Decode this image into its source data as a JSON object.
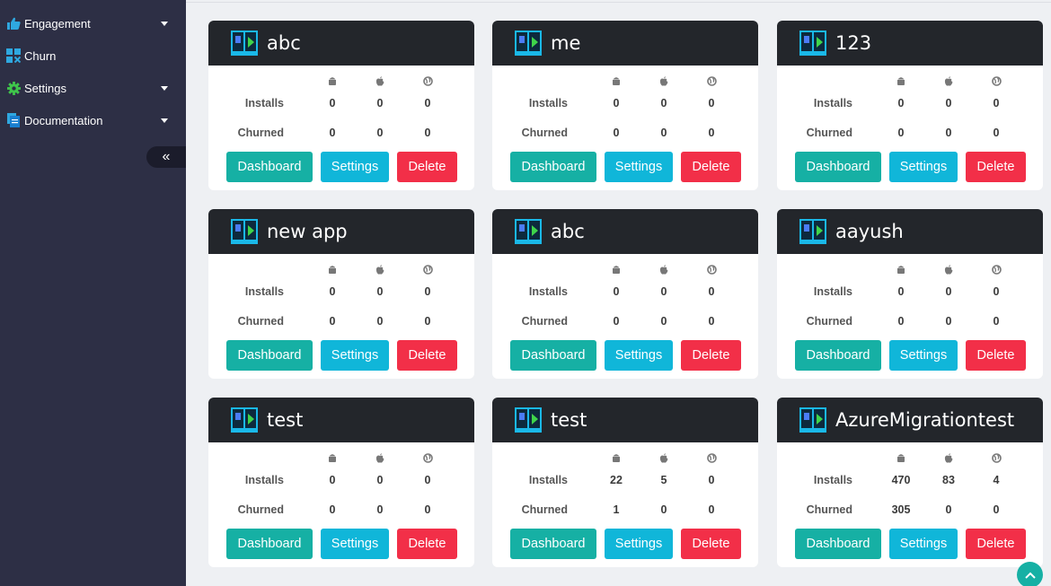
{
  "sidebar": {
    "items": [
      {
        "label": "Engagement",
        "icon": "thumbs-up-icon",
        "has_caret": true
      },
      {
        "label": "Churn",
        "icon": "churn-grid-icon",
        "has_caret": false
      },
      {
        "label": "Settings",
        "icon": "gear-icon",
        "has_caret": true
      },
      {
        "label": "Documentation",
        "icon": "document-icon",
        "has_caret": true
      }
    ],
    "collapse_label": "«"
  },
  "table_labels": {
    "installs": "Installs",
    "churned": "Churned"
  },
  "platform_icons": [
    "android-icon",
    "apple-icon",
    "globe-icon"
  ],
  "buttons": {
    "dashboard": "Dashboard",
    "settings": "Settings",
    "delete": "Delete"
  },
  "apps": [
    {
      "name": "abc",
      "installs": [
        "0",
        "0",
        "0"
      ],
      "churned": [
        "0",
        "0",
        "0"
      ]
    },
    {
      "name": "me",
      "installs": [
        "0",
        "0",
        "0"
      ],
      "churned": [
        "0",
        "0",
        "0"
      ]
    },
    {
      "name": "123",
      "installs": [
        "0",
        "0",
        "0"
      ],
      "churned": [
        "0",
        "0",
        "0"
      ]
    },
    {
      "name": "new app",
      "installs": [
        "0",
        "0",
        "0"
      ],
      "churned": [
        "0",
        "0",
        "0"
      ]
    },
    {
      "name": "abc",
      "installs": [
        "0",
        "0",
        "0"
      ],
      "churned": [
        "0",
        "0",
        "0"
      ]
    },
    {
      "name": "aayush",
      "installs": [
        "0",
        "0",
        "0"
      ],
      "churned": [
        "0",
        "0",
        "0"
      ]
    },
    {
      "name": "test",
      "installs": [
        "0",
        "0",
        "0"
      ],
      "churned": [
        "0",
        "0",
        "0"
      ]
    },
    {
      "name": "test",
      "installs": [
        "22",
        "5",
        "0"
      ],
      "churned": [
        "1",
        "0",
        "0"
      ]
    },
    {
      "name": "AzureMigrationtest",
      "installs": [
        "470",
        "83",
        "4"
      ],
      "churned": [
        "305",
        "0",
        "0"
      ]
    }
  ],
  "colors": {
    "sidebar_bg": "#2d2f45",
    "card_header_bg": "#23262b",
    "dashboard_button": "#16b0a4",
    "settings_button": "#10b6d9",
    "delete_button": "#f22f48",
    "accent_icon": "#1ab8e8"
  }
}
